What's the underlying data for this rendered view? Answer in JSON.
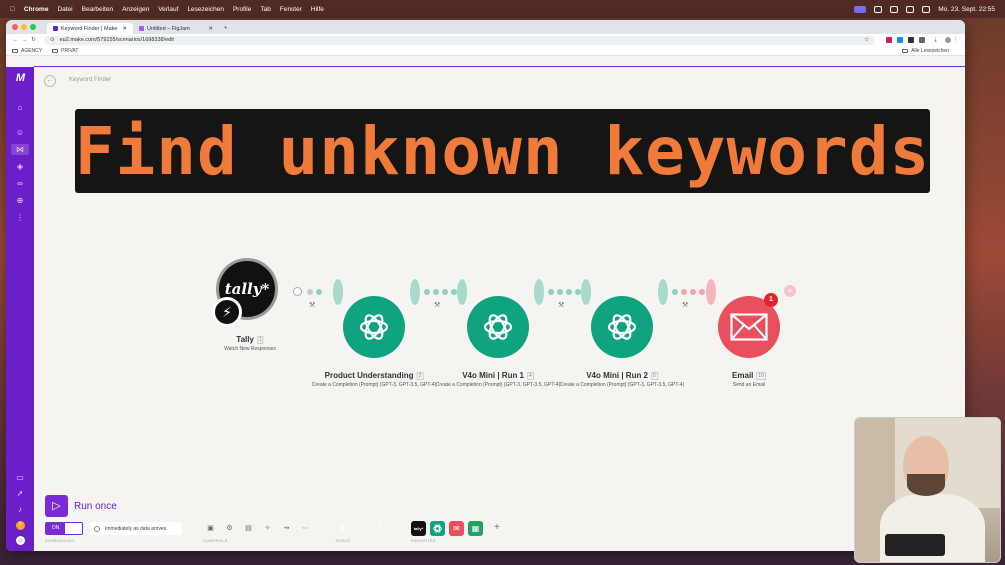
{
  "menubar": {
    "app": "Chrome",
    "items": [
      "Datei",
      "Bearbeiten",
      "Anzeigen",
      "Verlauf",
      "Lesezeichen",
      "Profile",
      "Tab",
      "Fenster",
      "Hilfe"
    ],
    "datetime": "Mo. 23. Sept.  22:55"
  },
  "browser": {
    "tabs": [
      {
        "title": "Keyword Finder | Make",
        "active": true
      },
      {
        "title": "Untitled – FigJam",
        "active": false
      }
    ],
    "url": "eu2.make.com/579155/scenarios/1698338/edit",
    "bookmarks": [
      "AGENCY",
      "PRIVAT"
    ],
    "all_bookmarks": "Alle Lesezeichen"
  },
  "scenario": {
    "name": "Keyword Finder",
    "banner": "Find unknown keywords"
  },
  "modules": [
    {
      "name": "Tally",
      "id": "1",
      "subtitle": "Watch New Responses",
      "icon": "tally-logo",
      "logo_text": "tally*",
      "color": "#111111"
    },
    {
      "name": "Product Understanding",
      "id": "3",
      "subtitle": "Create a Completion (Prompt) (GPT-3, GPT-3.5, GPT-4)",
      "icon": "openai-icon",
      "color": "#10a37f"
    },
    {
      "name": "V4o Mini | Run 1",
      "id": "4",
      "subtitle": "Create a Completion (Prompt) (GPT-3, GPT-3.5, GPT-4)",
      "icon": "openai-icon",
      "color": "#10a37f"
    },
    {
      "name": "V4o Mini | Run 2",
      "id": "5",
      "subtitle": "Create a Completion (Prompt) (GPT-3, GPT-3.5, GPT-4)",
      "icon": "openai-icon",
      "color": "#10a37f"
    },
    {
      "name": "Email",
      "id": "10",
      "subtitle": "Send an Email",
      "icon": "envelope-icon",
      "color": "#e8505f",
      "badge": "1"
    }
  ],
  "toolbar": {
    "run_label": "Run once",
    "toggle_on": "ON",
    "schedule_text": "Immediately as data arrives.",
    "sections": {
      "scheduling": "SCHEDULING",
      "controls": "CONTROLS",
      "tools": "TOOLS",
      "favorites": "FAVORITES"
    },
    "favorites": [
      {
        "icon": "tally-logo",
        "label": "tally*",
        "color": "#111111"
      },
      {
        "icon": "openai-icon",
        "color": "#10a37f"
      },
      {
        "icon": "envelope-icon",
        "color": "#e8505f"
      },
      {
        "icon": "sheets-icon",
        "color": "#21a366"
      }
    ],
    "tools_colors": [
      "#8bc34a",
      "#7e88ef",
      "#f26b3a"
    ]
  }
}
